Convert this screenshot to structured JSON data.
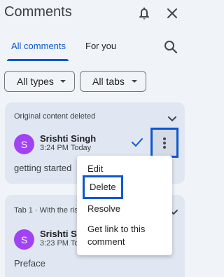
{
  "header": {
    "title": "Comments",
    "bell_icon": "bell-icon",
    "close_icon": "close-icon"
  },
  "tabs": [
    {
      "label": "All comments",
      "active": true
    },
    {
      "label": "For you",
      "active": false
    }
  ],
  "search_icon": "search-icon",
  "filters": [
    {
      "label": "All types"
    },
    {
      "label": "All tabs"
    }
  ],
  "threads": [
    {
      "title": "Original content deleted",
      "author": "Srishti Singh",
      "avatar_letter": "S",
      "time": "3:24 PM Today",
      "text": "getting started"
    },
    {
      "title": "Tab 1 · With the ris",
      "author": "Srishti Si",
      "avatar_letter": "S",
      "time": "3:23 PM To",
      "text": "Preface"
    }
  ],
  "menu": {
    "items": [
      "Edit",
      "Delete",
      "Resolve",
      "Get link to this",
      "comment"
    ]
  },
  "colors": {
    "accent": "#0b57d0",
    "avatar": "#a142f4",
    "background": "#f0f4f9",
    "card": "#e1e7f2"
  }
}
